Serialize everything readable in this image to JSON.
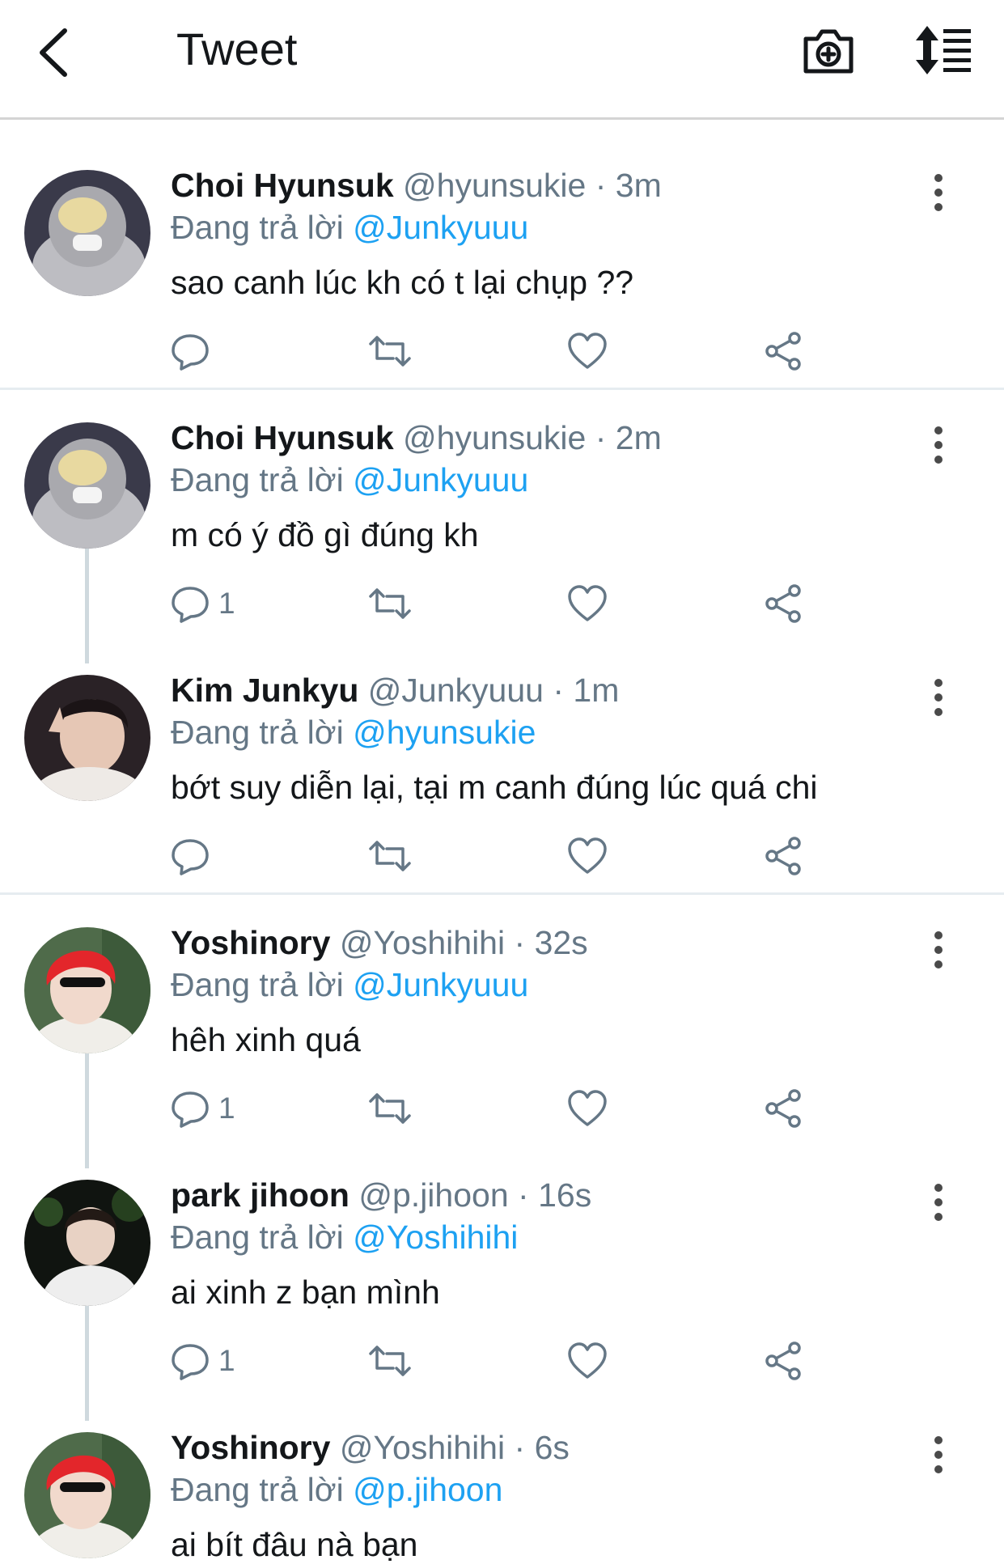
{
  "header": {
    "title": "Tweet",
    "back_icon": "chevron-left-icon",
    "camera_icon": "camera-plus-icon",
    "sort_icon": "sort-list-icon"
  },
  "colors": {
    "mention": "#1da1f2",
    "muted": "#657786",
    "text": "#14171a",
    "thread": "#cfd9de"
  },
  "reply_prefix": "Đang trả lời",
  "tweets": [
    {
      "name": "Choi Hyunsuk",
      "handle": "@hyunsukie",
      "time": "3m",
      "reply_to": "@Junkyuuu",
      "text": "sao canh lúc kh có t lại chụp ??",
      "reply_count": ""
    },
    {
      "name": "Choi Hyunsuk",
      "handle": "@hyunsukie",
      "time": "2m",
      "reply_to": "@Junkyuuu",
      "text": "m có ý đồ gì đúng kh",
      "reply_count": "1"
    },
    {
      "name": "Kim Junkyu",
      "handle": "@Junkyuuu",
      "time": "1m",
      "reply_to": "@hyunsukie",
      "text": "bớt suy diễn lại, tại m canh đúng lúc quá chi",
      "reply_count": ""
    },
    {
      "name": "Yoshinory",
      "handle": "@Yoshihihi",
      "time": "32s",
      "reply_to": "@Junkyuuu",
      "text": "hêh xinh quá",
      "reply_count": "1"
    },
    {
      "name": "park jihoon",
      "handle": "@p.jihoon",
      "time": "16s",
      "reply_to": "@Yoshihihi",
      "text": "ai xinh z bạn mình",
      "reply_count": "1"
    },
    {
      "name": "Yoshinory",
      "handle": "@Yoshihihi",
      "time": "6s",
      "reply_to": "@p.jihoon",
      "text": "ai bít đâu nà bạn",
      "reply_count": ""
    }
  ]
}
